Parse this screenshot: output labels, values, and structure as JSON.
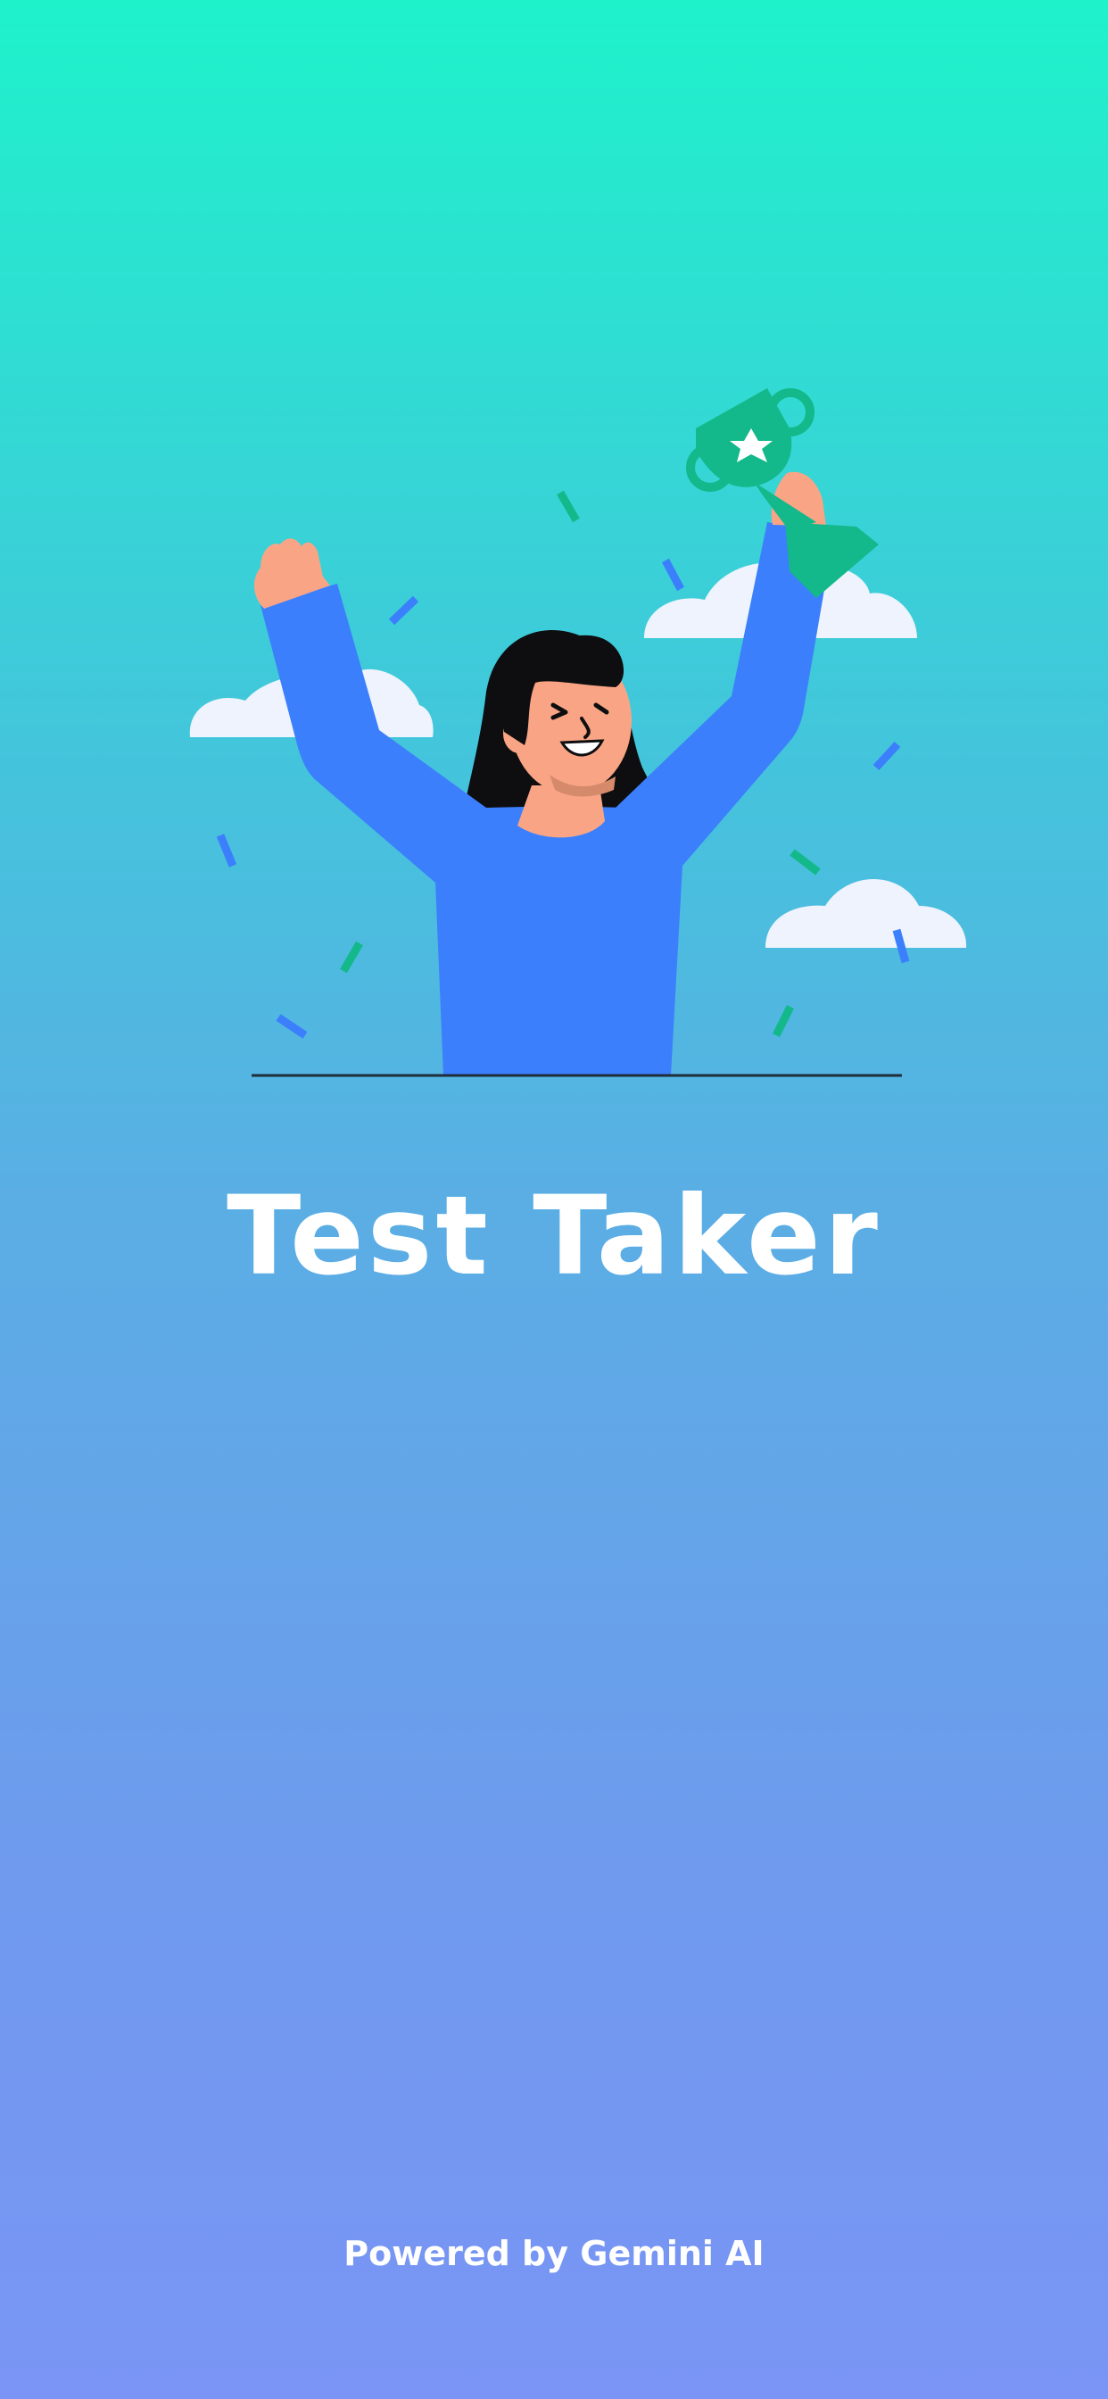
{
  "app": {
    "title": "Test Taker",
    "footer": "Powered by Gemini AI"
  },
  "illustration": {
    "subject": "woman-holding-trophy",
    "icons": [
      "trophy-icon",
      "star-icon",
      "cloud-icon",
      "confetti-icon"
    ]
  },
  "colors": {
    "background_top": "#1ef2cb",
    "background_bottom": "#7a95f5",
    "shirt": "#3b7ffc",
    "trophy": "#13b98a",
    "skin": "#f9a585",
    "hair": "#0e0e10",
    "cloud": "#eef3fd",
    "text": "#ffffff"
  }
}
